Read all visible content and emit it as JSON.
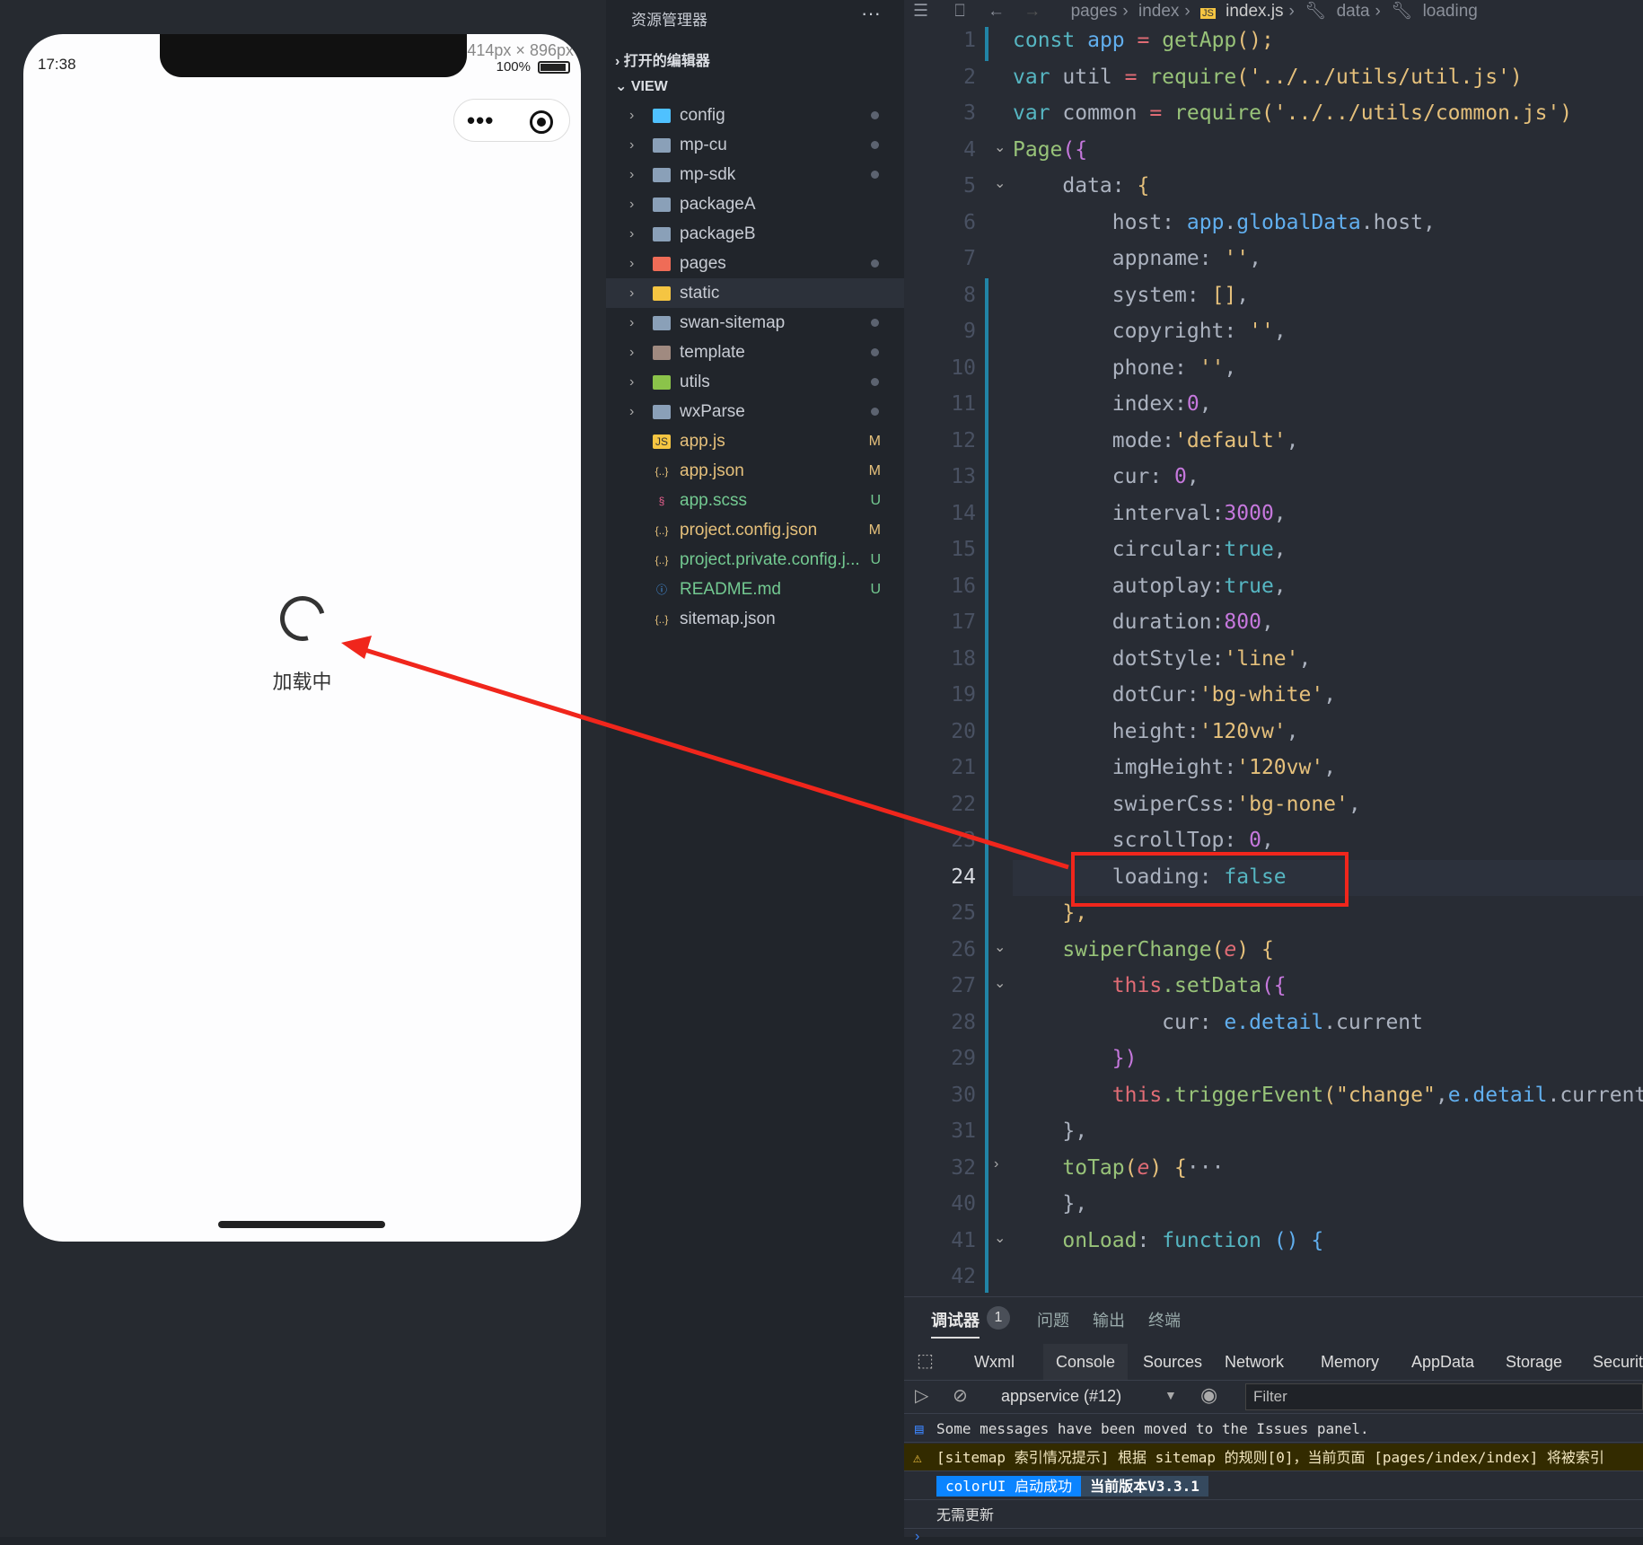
{
  "simulator": {
    "time": "17:38",
    "dimensions": "414px × 896px",
    "zoom": "100%",
    "loading_text": "加载中"
  },
  "sidebar": {
    "title": "资源管理器",
    "more": "···",
    "open_editors": "打开的编辑器",
    "view": "VIEW",
    "items": [
      {
        "name": "config",
        "type": "folder",
        "icon_color": "#4fc1ff",
        "status": "dot"
      },
      {
        "name": "mp-cu",
        "type": "folder",
        "icon_color": "#8aa0b8",
        "status": "dot"
      },
      {
        "name": "mp-sdk",
        "type": "folder",
        "icon_color": "#8aa0b8",
        "status": "dot"
      },
      {
        "name": "packageA",
        "type": "folder",
        "icon_color": "#8aa0b8",
        "status": ""
      },
      {
        "name": "packageB",
        "type": "folder",
        "icon_color": "#8aa0b8",
        "status": ""
      },
      {
        "name": "pages",
        "type": "folder",
        "icon_color": "#ef6c57",
        "status": "dot"
      },
      {
        "name": "static",
        "type": "folder",
        "icon_color": "#f5c542",
        "status": ""
      },
      {
        "name": "swan-sitemap",
        "type": "folder",
        "icon_color": "#8aa0b8",
        "status": "dot"
      },
      {
        "name": "template",
        "type": "folder",
        "icon_color": "#a08a80",
        "status": "dot"
      },
      {
        "name": "utils",
        "type": "folder",
        "icon_color": "#8bc34a",
        "status": "dot"
      },
      {
        "name": "wxParse",
        "type": "folder",
        "icon_color": "#8aa0b8",
        "status": "dot"
      },
      {
        "name": "app.js",
        "type": "js",
        "icon_color": "#f5c542",
        "status": "M"
      },
      {
        "name": "app.json",
        "type": "json",
        "icon_color": "#e5c07b",
        "status": "M"
      },
      {
        "name": "app.scss",
        "type": "scss",
        "icon_color": "#f06292",
        "status": "U"
      },
      {
        "name": "project.config.json",
        "type": "json",
        "icon_color": "#e5c07b",
        "status": "M"
      },
      {
        "name": "project.private.config.j...",
        "type": "json",
        "icon_color": "#e5c07b",
        "status": "U"
      },
      {
        "name": "README.md",
        "type": "info",
        "icon_color": "#4a9ff5",
        "status": "U"
      },
      {
        "name": "sitemap.json",
        "type": "json",
        "icon_color": "#e5c07b",
        "status": ""
      }
    ]
  },
  "breadcrumb": [
    "pages",
    "index",
    "index.js",
    "data",
    "loading"
  ],
  "editor": {
    "current_line": "24",
    "lines": [
      {
        "n": "1",
        "t": [
          [
            "const ",
            "k"
          ],
          [
            "app",
            "v"
          ],
          [
            " = ",
            "r"
          ],
          [
            "getApp",
            "f"
          ],
          [
            "();",
            "p"
          ]
        ]
      },
      {
        "n": "2",
        "t": [
          [
            "var ",
            "k"
          ],
          [
            "util",
            "pl"
          ],
          [
            " = ",
            "r"
          ],
          [
            "require",
            "f"
          ],
          [
            "('../../utils/util.js')",
            "s"
          ]
        ]
      },
      {
        "n": "3",
        "t": [
          [
            "var ",
            "k"
          ],
          [
            "common",
            "pl"
          ],
          [
            " = ",
            "r"
          ],
          [
            "require",
            "f"
          ],
          [
            "('../../utils/common.js')",
            "s"
          ]
        ]
      },
      {
        "n": "4",
        "t": [
          [
            "Page",
            "f"
          ],
          [
            "({",
            "n"
          ]
        ]
      },
      {
        "n": "5",
        "t": [
          [
            "    data: ",
            "pl"
          ],
          [
            "{",
            "p"
          ]
        ]
      },
      {
        "n": "6",
        "t": [
          [
            "        host: ",
            "pl"
          ],
          [
            "app",
            "v"
          ],
          [
            ".",
            "pl"
          ],
          [
            "globalData",
            "v"
          ],
          [
            ".host,",
            "pl"
          ]
        ]
      },
      {
        "n": "7",
        "t": [
          [
            "        appname: ",
            "pl"
          ],
          [
            "''",
            "s"
          ],
          [
            ",",
            "pl"
          ]
        ]
      },
      {
        "n": "8",
        "t": [
          [
            "        system: ",
            "pl"
          ],
          [
            "[]",
            "p"
          ],
          [
            ",",
            "pl"
          ]
        ]
      },
      {
        "n": "9",
        "t": [
          [
            "        copyright: ",
            "pl"
          ],
          [
            "''",
            "s"
          ],
          [
            ",",
            "pl"
          ]
        ]
      },
      {
        "n": "10",
        "t": [
          [
            "        phone: ",
            "pl"
          ],
          [
            "''",
            "s"
          ],
          [
            ",",
            "pl"
          ]
        ]
      },
      {
        "n": "11",
        "t": [
          [
            "        index:",
            "pl"
          ],
          [
            "0",
            "n"
          ],
          [
            ",",
            "pl"
          ]
        ]
      },
      {
        "n": "12",
        "t": [
          [
            "        mode:",
            "pl"
          ],
          [
            "'default'",
            "s"
          ],
          [
            ",",
            "pl"
          ]
        ]
      },
      {
        "n": "13",
        "t": [
          [
            "        cur: ",
            "pl"
          ],
          [
            "0",
            "n"
          ],
          [
            ",",
            "pl"
          ]
        ]
      },
      {
        "n": "14",
        "t": [
          [
            "        interval:",
            "pl"
          ],
          [
            "3000",
            "n"
          ],
          [
            ",",
            "pl"
          ]
        ]
      },
      {
        "n": "15",
        "t": [
          [
            "        circular:",
            "pl"
          ],
          [
            "true",
            "b"
          ],
          [
            ",",
            "pl"
          ]
        ]
      },
      {
        "n": "16",
        "t": [
          [
            "        autoplay:",
            "pl"
          ],
          [
            "true",
            "b"
          ],
          [
            ",",
            "pl"
          ]
        ]
      },
      {
        "n": "17",
        "t": [
          [
            "        duration:",
            "pl"
          ],
          [
            "800",
            "n"
          ],
          [
            ",",
            "pl"
          ]
        ]
      },
      {
        "n": "18",
        "t": [
          [
            "        dotStyle:",
            "pl"
          ],
          [
            "'line'",
            "s"
          ],
          [
            ",",
            "pl"
          ]
        ]
      },
      {
        "n": "19",
        "t": [
          [
            "        dotCur:",
            "pl"
          ],
          [
            "'bg-white'",
            "s"
          ],
          [
            ",",
            "pl"
          ]
        ]
      },
      {
        "n": "20",
        "t": [
          [
            "        height:",
            "pl"
          ],
          [
            "'120vw'",
            "s"
          ],
          [
            ",",
            "pl"
          ]
        ]
      },
      {
        "n": "21",
        "t": [
          [
            "        imgHeight:",
            "pl"
          ],
          [
            "'120vw'",
            "s"
          ],
          [
            ",",
            "pl"
          ]
        ]
      },
      {
        "n": "22",
        "t": [
          [
            "        swiperCss:",
            "pl"
          ],
          [
            "'bg-none'",
            "s"
          ],
          [
            ",",
            "pl"
          ]
        ]
      },
      {
        "n": "23",
        "t": [
          [
            "        scrollTop: ",
            "pl"
          ],
          [
            "0",
            "n"
          ],
          [
            ",",
            "pl"
          ]
        ]
      },
      {
        "n": "24",
        "t": [
          [
            "        loading: ",
            "pl"
          ],
          [
            "false",
            "b"
          ]
        ]
      },
      {
        "n": "25",
        "t": [
          [
            "    },",
            "p"
          ]
        ]
      },
      {
        "n": "26",
        "t": [
          [
            "    swiperChange",
            "f"
          ],
          [
            "(",
            "p"
          ],
          [
            "e",
            "i"
          ],
          [
            ") {",
            "p"
          ]
        ]
      },
      {
        "n": "27",
        "t": [
          [
            "        this",
            "r"
          ],
          [
            ".setData",
            "f"
          ],
          [
            "({",
            "n"
          ]
        ]
      },
      {
        "n": "28",
        "t": [
          [
            "            cur: ",
            "pl"
          ],
          [
            "e",
            "v"
          ],
          [
            ".detail",
            "v"
          ],
          [
            ".current",
            "pl"
          ]
        ]
      },
      {
        "n": "29",
        "t": [
          [
            "        })",
            "n"
          ]
        ]
      },
      {
        "n": "30",
        "t": [
          [
            "        this",
            "r"
          ],
          [
            ".triggerEvent",
            "f"
          ],
          [
            "(",
            "p"
          ],
          [
            "\"change\"",
            "s"
          ],
          [
            ",",
            "pl"
          ],
          [
            "e",
            "v"
          ],
          [
            ".detail",
            "v"
          ],
          [
            ".current",
            "pl"
          ]
        ]
      },
      {
        "n": "31",
        "t": [
          [
            "    },",
            "pl"
          ]
        ]
      },
      {
        "n": "32",
        "t": [
          [
            "    toTap",
            "f"
          ],
          [
            "(",
            "p"
          ],
          [
            "e",
            "i"
          ],
          [
            ") {",
            "p"
          ],
          [
            "···",
            "pl"
          ]
        ]
      },
      {
        "n": "40",
        "t": [
          [
            "    },",
            "pl"
          ]
        ]
      },
      {
        "n": "41",
        "t": [
          [
            "    onLoad",
            "f"
          ],
          [
            ": ",
            "pl"
          ],
          [
            "function",
            "k"
          ],
          [
            " () {",
            "v"
          ]
        ]
      },
      {
        "n": "42",
        "t": []
      }
    ]
  },
  "panel": {
    "tabs": [
      "调试器",
      "问题",
      "输出",
      "终端"
    ],
    "badge": "1",
    "devtools_tabs": [
      "Wxml",
      "Console",
      "Sources",
      "Network",
      "Memory",
      "AppData",
      "Storage",
      "Security"
    ],
    "context": "appservice (#12)",
    "filter_placeholder": "Filter",
    "messages": {
      "info": "Some messages have been moved to the Issues panel.",
      "warn": "[sitemap 索引情况提示] 根据 sitemap 的规则[0]，当前页面 [pages/index/index] 将被索引",
      "tag1": "colorUI 启动成功",
      "tag2": "当前版本V3.3.1",
      "plain": "无需更新"
    }
  },
  "colors": {
    "highlight_box": "#f0261c",
    "accent": "#2184a6"
  }
}
